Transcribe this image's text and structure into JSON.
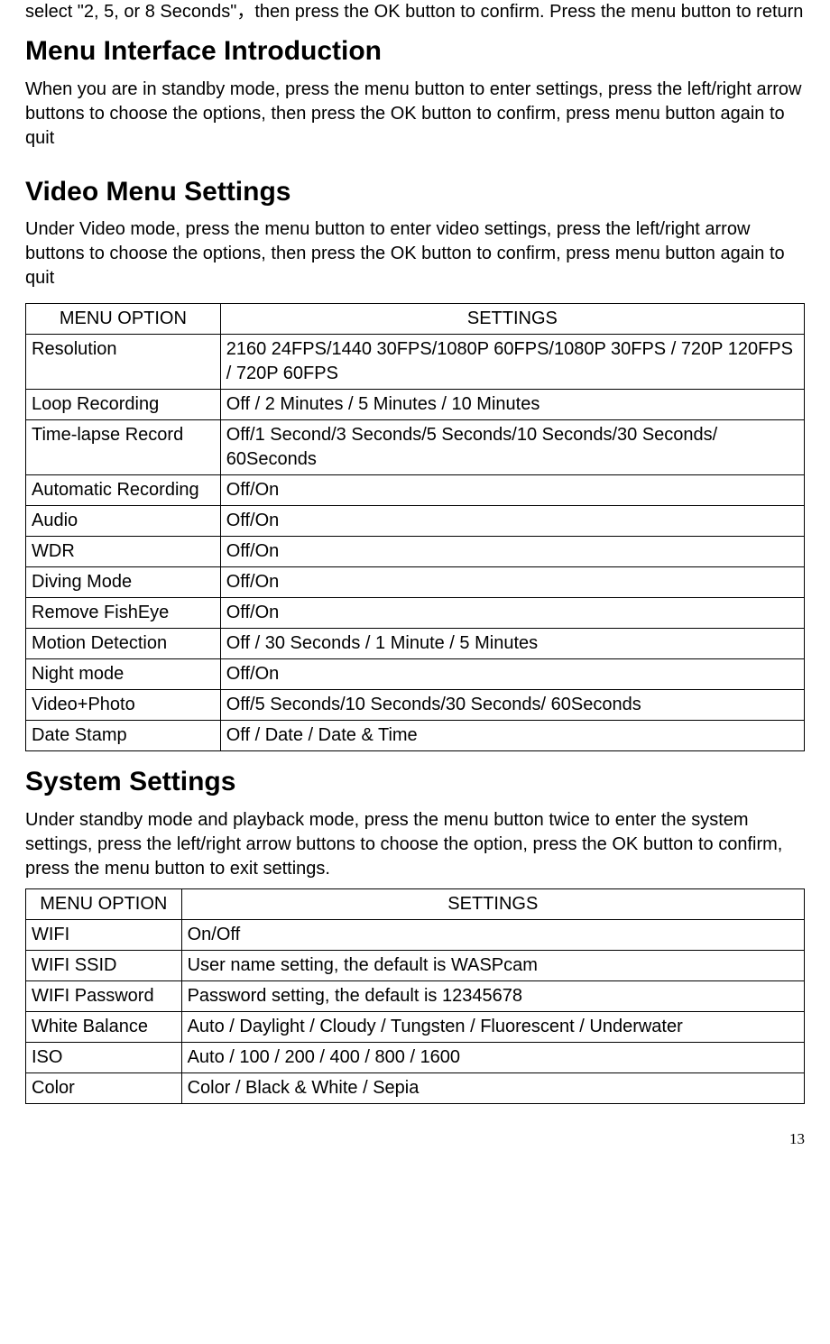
{
  "intro_text": "select \"2, 5, or 8 Seconds\"，then press the OK button to confirm. Press the menu button to return",
  "section1": {
    "heading": "Menu Interface Introduction",
    "body": "When you are in standby mode, press the menu button to enter settings, press the left/right arrow buttons to choose the options, then press the OK button to confirm, press menu button again to quit"
  },
  "section2": {
    "heading": "Video Menu Settings",
    "body": "Under Video mode, press the menu button to enter video settings, press the left/right arrow buttons to choose the options, then press the OK button to confirm, press menu button again to quit",
    "table": {
      "headers": [
        "MENU OPTION",
        "SETTINGS"
      ],
      "rows": [
        [
          "Resolution",
          "2160 24FPS/1440 30FPS/1080P 60FPS/1080P 30FPS / 720P 120FPS / 720P 60FPS"
        ],
        [
          "Loop Recording",
          "Off / 2 Minutes / 5 Minutes / 10 Minutes"
        ],
        [
          "Time-lapse Record",
          "Off/1 Second/3 Seconds/5 Seconds/10 Seconds/30 Seconds/ 60Seconds"
        ],
        [
          "Automatic Recording",
          "Off/On"
        ],
        [
          "Audio",
          "Off/On"
        ],
        [
          "WDR",
          "Off/On"
        ],
        [
          "Diving Mode",
          "Off/On"
        ],
        [
          "Remove FishEye",
          "Off/On"
        ],
        [
          "Motion Detection",
          "Off / 30 Seconds / 1 Minute / 5 Minutes"
        ],
        [
          "Night mode",
          "Off/On"
        ],
        [
          "Video+Photo",
          "Off/5 Seconds/10 Seconds/30 Seconds/ 60Seconds"
        ],
        [
          "Date Stamp",
          "Off / Date / Date & Time"
        ]
      ]
    }
  },
  "section3": {
    "heading": "System Settings",
    "body": "Under standby mode and playback mode, press the menu button twice to enter the system settings, press the left/right arrow buttons to choose the option, press the OK button to confirm, press the menu button to exit settings.",
    "table": {
      "headers": [
        "MENU OPTION",
        "SETTINGS"
      ],
      "rows": [
        [
          "WIFI",
          "On/Off"
        ],
        [
          "WIFI SSID",
          "User name setting, the default is WASPcam"
        ],
        [
          "WIFI Password",
          "Password setting, the default is 12345678"
        ],
        [
          "White Balance",
          "Auto / Daylight / Cloudy / Tungsten / Fluorescent / Underwater"
        ],
        [
          "ISO",
          "Auto / 100 / 200 / 400 / 800 / 1600"
        ],
        [
          "Color",
          "Color / Black & White / Sepia"
        ]
      ]
    }
  },
  "page_number": "13"
}
